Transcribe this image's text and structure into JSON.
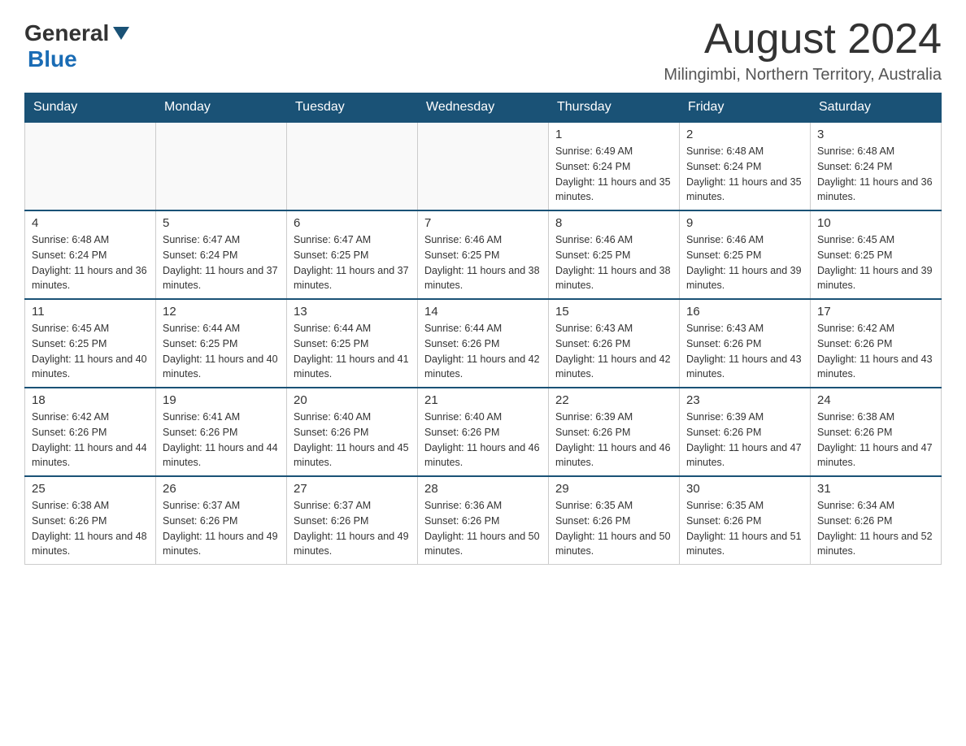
{
  "header": {
    "logo_general": "General",
    "logo_blue": "Blue",
    "month_title": "August 2024",
    "location": "Milingimbi, Northern Territory, Australia"
  },
  "calendar": {
    "days_of_week": [
      "Sunday",
      "Monday",
      "Tuesday",
      "Wednesday",
      "Thursday",
      "Friday",
      "Saturday"
    ],
    "weeks": [
      [
        {
          "day": "",
          "info": ""
        },
        {
          "day": "",
          "info": ""
        },
        {
          "day": "",
          "info": ""
        },
        {
          "day": "",
          "info": ""
        },
        {
          "day": "1",
          "info": "Sunrise: 6:49 AM\nSunset: 6:24 PM\nDaylight: 11 hours and 35 minutes."
        },
        {
          "day": "2",
          "info": "Sunrise: 6:48 AM\nSunset: 6:24 PM\nDaylight: 11 hours and 35 minutes."
        },
        {
          "day": "3",
          "info": "Sunrise: 6:48 AM\nSunset: 6:24 PM\nDaylight: 11 hours and 36 minutes."
        }
      ],
      [
        {
          "day": "4",
          "info": "Sunrise: 6:48 AM\nSunset: 6:24 PM\nDaylight: 11 hours and 36 minutes."
        },
        {
          "day": "5",
          "info": "Sunrise: 6:47 AM\nSunset: 6:24 PM\nDaylight: 11 hours and 37 minutes."
        },
        {
          "day": "6",
          "info": "Sunrise: 6:47 AM\nSunset: 6:25 PM\nDaylight: 11 hours and 37 minutes."
        },
        {
          "day": "7",
          "info": "Sunrise: 6:46 AM\nSunset: 6:25 PM\nDaylight: 11 hours and 38 minutes."
        },
        {
          "day": "8",
          "info": "Sunrise: 6:46 AM\nSunset: 6:25 PM\nDaylight: 11 hours and 38 minutes."
        },
        {
          "day": "9",
          "info": "Sunrise: 6:46 AM\nSunset: 6:25 PM\nDaylight: 11 hours and 39 minutes."
        },
        {
          "day": "10",
          "info": "Sunrise: 6:45 AM\nSunset: 6:25 PM\nDaylight: 11 hours and 39 minutes."
        }
      ],
      [
        {
          "day": "11",
          "info": "Sunrise: 6:45 AM\nSunset: 6:25 PM\nDaylight: 11 hours and 40 minutes."
        },
        {
          "day": "12",
          "info": "Sunrise: 6:44 AM\nSunset: 6:25 PM\nDaylight: 11 hours and 40 minutes."
        },
        {
          "day": "13",
          "info": "Sunrise: 6:44 AM\nSunset: 6:25 PM\nDaylight: 11 hours and 41 minutes."
        },
        {
          "day": "14",
          "info": "Sunrise: 6:44 AM\nSunset: 6:26 PM\nDaylight: 11 hours and 42 minutes."
        },
        {
          "day": "15",
          "info": "Sunrise: 6:43 AM\nSunset: 6:26 PM\nDaylight: 11 hours and 42 minutes."
        },
        {
          "day": "16",
          "info": "Sunrise: 6:43 AM\nSunset: 6:26 PM\nDaylight: 11 hours and 43 minutes."
        },
        {
          "day": "17",
          "info": "Sunrise: 6:42 AM\nSunset: 6:26 PM\nDaylight: 11 hours and 43 minutes."
        }
      ],
      [
        {
          "day": "18",
          "info": "Sunrise: 6:42 AM\nSunset: 6:26 PM\nDaylight: 11 hours and 44 minutes."
        },
        {
          "day": "19",
          "info": "Sunrise: 6:41 AM\nSunset: 6:26 PM\nDaylight: 11 hours and 44 minutes."
        },
        {
          "day": "20",
          "info": "Sunrise: 6:40 AM\nSunset: 6:26 PM\nDaylight: 11 hours and 45 minutes."
        },
        {
          "day": "21",
          "info": "Sunrise: 6:40 AM\nSunset: 6:26 PM\nDaylight: 11 hours and 46 minutes."
        },
        {
          "day": "22",
          "info": "Sunrise: 6:39 AM\nSunset: 6:26 PM\nDaylight: 11 hours and 46 minutes."
        },
        {
          "day": "23",
          "info": "Sunrise: 6:39 AM\nSunset: 6:26 PM\nDaylight: 11 hours and 47 minutes."
        },
        {
          "day": "24",
          "info": "Sunrise: 6:38 AM\nSunset: 6:26 PM\nDaylight: 11 hours and 47 minutes."
        }
      ],
      [
        {
          "day": "25",
          "info": "Sunrise: 6:38 AM\nSunset: 6:26 PM\nDaylight: 11 hours and 48 minutes."
        },
        {
          "day": "26",
          "info": "Sunrise: 6:37 AM\nSunset: 6:26 PM\nDaylight: 11 hours and 49 minutes."
        },
        {
          "day": "27",
          "info": "Sunrise: 6:37 AM\nSunset: 6:26 PM\nDaylight: 11 hours and 49 minutes."
        },
        {
          "day": "28",
          "info": "Sunrise: 6:36 AM\nSunset: 6:26 PM\nDaylight: 11 hours and 50 minutes."
        },
        {
          "day": "29",
          "info": "Sunrise: 6:35 AM\nSunset: 6:26 PM\nDaylight: 11 hours and 50 minutes."
        },
        {
          "day": "30",
          "info": "Sunrise: 6:35 AM\nSunset: 6:26 PM\nDaylight: 11 hours and 51 minutes."
        },
        {
          "day": "31",
          "info": "Sunrise: 6:34 AM\nSunset: 6:26 PM\nDaylight: 11 hours and 52 minutes."
        }
      ]
    ]
  }
}
